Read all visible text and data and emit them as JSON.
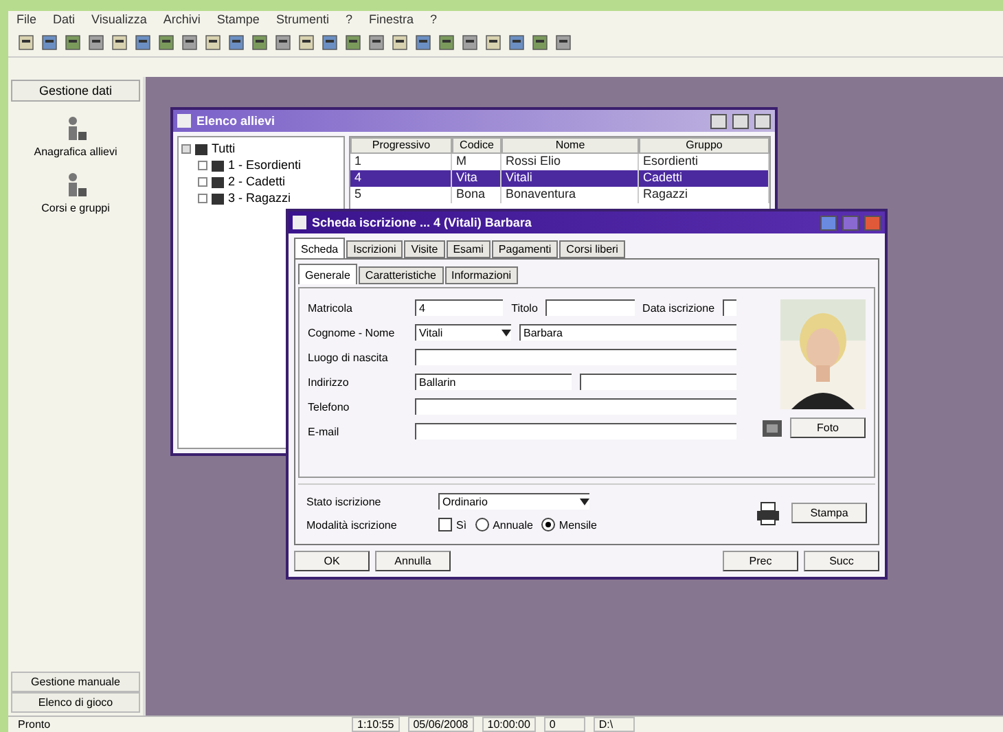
{
  "menu": [
    "File",
    "Dati",
    "Visualizza",
    "Archivi",
    "Stampe",
    "Strumenti",
    "?",
    "Finestra",
    "?"
  ],
  "sidebar": {
    "header": "Gestione dati",
    "items": [
      "Anagrafica allievi",
      "Corsi e gruppi"
    ],
    "bottom_buttons": [
      "Gestione manuale",
      "Elenco di gioco"
    ]
  },
  "list_window": {
    "title": "Elenco allievi",
    "tree": [
      {
        "label": "Tutti",
        "expanded": true,
        "children": [
          {
            "label": "1 - Esordienti",
            "expanded": false
          },
          {
            "label": "2 - Cadetti",
            "expanded": false
          },
          {
            "label": "3 - Ragazzi",
            "expanded": false
          }
        ]
      }
    ],
    "columns": [
      "Progressivo",
      "Codice",
      "Nome",
      "Gruppo"
    ],
    "rows": [
      {
        "cells": [
          "1",
          "M",
          "Rossi Elio",
          "Esordienti"
        ],
        "selected": false
      },
      {
        "cells": [
          "4",
          "Vita",
          "Vitali",
          "Cadetti"
        ],
        "selected": true
      },
      {
        "cells": [
          "5",
          "Bona",
          "Bonaventura",
          "Ragazzi"
        ],
        "selected": false
      }
    ]
  },
  "dialog": {
    "title": "Scheda iscrizione ... 4 (Vitali) Barbara",
    "tabs": [
      {
        "label": "Scheda",
        "selected": true
      },
      {
        "label": "Iscrizioni",
        "selected": false
      },
      {
        "label": "Visite",
        "selected": false
      },
      {
        "label": "Esami",
        "selected": false
      },
      {
        "label": "Pagamenti",
        "selected": false
      },
      {
        "label": "Corsi liberi",
        "selected": false
      }
    ],
    "subtabs": [
      {
        "label": "Generale",
        "selected": true
      },
      {
        "label": "Caratteristiche",
        "selected": false
      },
      {
        "label": "Informazioni",
        "selected": false
      }
    ],
    "form_rows": [
      [
        {
          "kind": "label",
          "text": "Matricola"
        },
        {
          "kind": "text",
          "value": "4"
        },
        {
          "kind": "label",
          "text": "Titolo"
        },
        {
          "kind": "text"
        },
        {
          "kind": "label",
          "text": "Data iscrizione"
        },
        {
          "kind": "small"
        }
      ],
      [
        {
          "kind": "label",
          "text": "Cognome - Nome"
        },
        {
          "kind": "combo",
          "value": "Vitali"
        },
        {
          "kind": "text",
          "value": "Barbara"
        }
      ],
      [
        {
          "kind": "label",
          "text": "Luogo di nascita"
        },
        {
          "kind": "text"
        }
      ],
      [
        {
          "kind": "label",
          "text": "Indirizzo"
        },
        {
          "kind": "text",
          "value": "Ballarin"
        },
        {
          "kind": "text"
        }
      ],
      [
        {
          "kind": "label",
          "text": "Telefono"
        },
        {
          "kind": "text"
        }
      ],
      [
        {
          "kind": "label",
          "text": "E-mail"
        },
        {
          "kind": "text"
        }
      ]
    ],
    "photo_button": "Foto",
    "status_label": "Stato iscrizione",
    "status_value": "Ordinario",
    "mode_label": "Modalità iscrizione",
    "options": [
      {
        "kind": "check",
        "label": "Sì",
        "checked": false
      },
      {
        "kind": "radio",
        "label": "Annuale",
        "selected": false
      },
      {
        "kind": "radio",
        "label": "Mensile",
        "selected": true
      }
    ],
    "print_button": "Stampa",
    "buttons": [
      "OK",
      "Annulla",
      "Prec",
      "Succ"
    ]
  },
  "status_bar": [
    "Pronto",
    "1:10:55",
    "05/06/2008",
    "10:00:00",
    "0",
    "D:\\"
  ]
}
